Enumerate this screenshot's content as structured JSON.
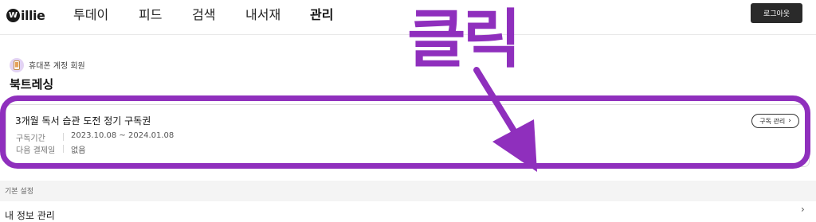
{
  "brand": {
    "logo_mark": "W",
    "logo_text": "illie"
  },
  "nav": {
    "today": "투데이",
    "feed": "피드",
    "search": "검색",
    "library": "내서재",
    "manage": "관리"
  },
  "header": {
    "logout_label": "로그아웃"
  },
  "member": {
    "label": "휴대폰 계정 회원",
    "icon": "phone-icon"
  },
  "page": {
    "title": "북트레싱"
  },
  "subscription": {
    "title": "3개월 독서 습관 도전 정기 구독권",
    "manage_label": "구독 관리",
    "period_label": "구독기간",
    "period_value": "2023.10.08 ~ 2024.01.08",
    "next_payment_label": "다음 결제일",
    "next_payment_value": "없음"
  },
  "settings": {
    "section_title": "기본 설정",
    "my_info_label": "내 정보 관리"
  },
  "annotation": {
    "text": "클릭",
    "color": "#8f2fbd"
  }
}
